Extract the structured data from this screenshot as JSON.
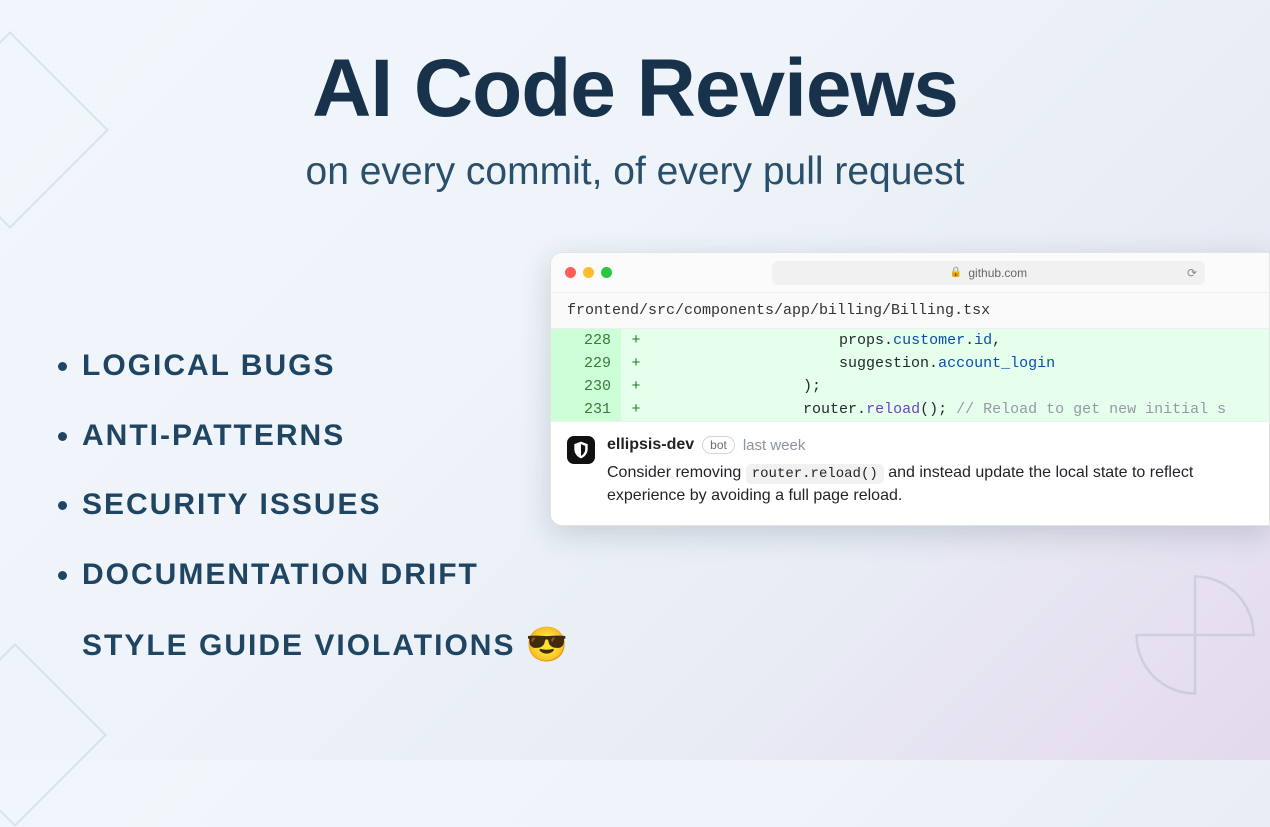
{
  "hero": {
    "title": "AI Code Reviews",
    "subtitle": "on every commit, of every pull request"
  },
  "features": {
    "items": [
      "LOGICAL BUGS",
      "ANTI-PATTERNS",
      "SECURITY ISSUES",
      "DOCUMENTATION DRIFT",
      "STYLE GUIDE VIOLATIONS"
    ],
    "emoji": "😎"
  },
  "browser": {
    "url": "github.com",
    "file_path": "frontend/src/components/app/billing/Billing.tsx",
    "diff": [
      {
        "line": "228",
        "tokens": [
          {
            "t": "                    ",
            "c": "default"
          },
          {
            "t": "props",
            "c": "default"
          },
          {
            "t": ".",
            "c": "punc"
          },
          {
            "t": "customer",
            "c": "attr"
          },
          {
            "t": ".",
            "c": "punc"
          },
          {
            "t": "id",
            "c": "attr"
          },
          {
            "t": ",",
            "c": "punc"
          }
        ]
      },
      {
        "line": "229",
        "tokens": [
          {
            "t": "                    ",
            "c": "default"
          },
          {
            "t": "suggestion",
            "c": "default"
          },
          {
            "t": ".",
            "c": "punc"
          },
          {
            "t": "account_login",
            "c": "attr"
          }
        ]
      },
      {
        "line": "230",
        "tokens": [
          {
            "t": "                ",
            "c": "default"
          },
          {
            "t": ");",
            "c": "punc"
          }
        ]
      },
      {
        "line": "231",
        "tokens": [
          {
            "t": "                ",
            "c": "default"
          },
          {
            "t": "router",
            "c": "default"
          },
          {
            "t": ".",
            "c": "punc"
          },
          {
            "t": "reload",
            "c": "func"
          },
          {
            "t": "();",
            "c": "punc"
          },
          {
            "t": " // Reload to get new initial s",
            "c": "comment"
          }
        ]
      }
    ],
    "comment": {
      "author": "ellipsis-dev",
      "badge": "bot",
      "time": "last week",
      "text_before": "Consider removing ",
      "code": "router.reload()",
      "text_after": " and instead update the local state to reflect experience by avoiding a full page reload."
    }
  }
}
